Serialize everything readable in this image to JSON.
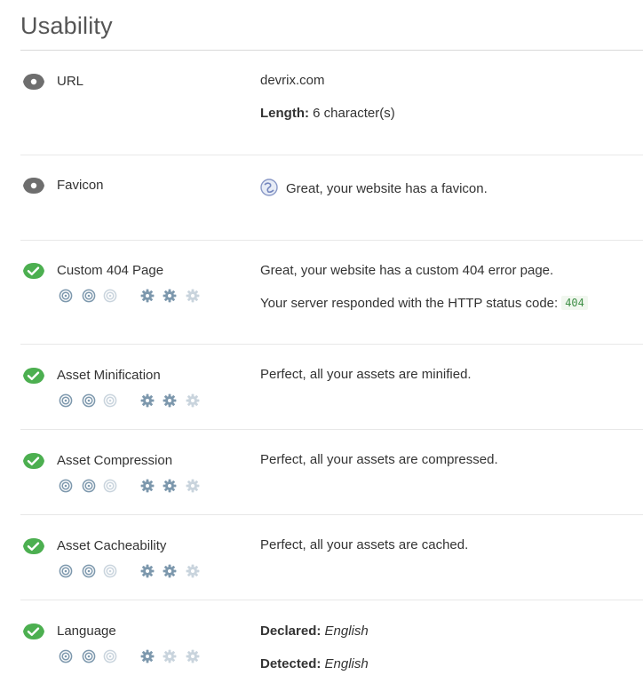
{
  "title": "Usability",
  "colors": {
    "pass": "#4caf50",
    "info": "#6e6e6e",
    "score_on": "#7d98ad",
    "score_off": "#c9d4dd"
  },
  "rows": [
    {
      "status": "info",
      "label": "URL",
      "lines": [
        {
          "text": "devrix.com"
        },
        {
          "key": "Length:",
          "text": "6 character(s)"
        }
      ]
    },
    {
      "status": "info",
      "label": "Favicon",
      "lines": [
        {
          "icon": "globe-favicon-icon",
          "text": "Great, your website has a favicon."
        }
      ]
    },
    {
      "status": "pass",
      "label": "Custom 404 Page",
      "scores": {
        "targets_active": 2,
        "targets_total": 3,
        "gears_active": 2,
        "gears_total": 3
      },
      "lines": [
        {
          "text": "Great, your website has a custom 404 error page."
        },
        {
          "text": "Your server responded with the HTTP status code:",
          "badge": "404"
        }
      ]
    },
    {
      "status": "pass",
      "label": "Asset Minification",
      "scores": {
        "targets_active": 2,
        "targets_total": 3,
        "gears_active": 2,
        "gears_total": 3
      },
      "lines": [
        {
          "text": "Perfect, all your assets are minified."
        }
      ]
    },
    {
      "status": "pass",
      "label": "Asset Compression",
      "scores": {
        "targets_active": 2,
        "targets_total": 3,
        "gears_active": 2,
        "gears_total": 3
      },
      "lines": [
        {
          "text": "Perfect, all your assets are compressed."
        }
      ]
    },
    {
      "status": "pass",
      "label": "Asset Cacheability",
      "scores": {
        "targets_active": 2,
        "targets_total": 3,
        "gears_active": 2,
        "gears_total": 3
      },
      "lines": [
        {
          "text": "Perfect, all your assets are cached."
        }
      ]
    },
    {
      "status": "pass",
      "label": "Language",
      "scores": {
        "targets_active": 2,
        "targets_total": 3,
        "gears_active": 1,
        "gears_total": 3
      },
      "lines": [
        {
          "key": "Declared:",
          "italic": "English"
        },
        {
          "key": "Detected:",
          "italic": "English"
        }
      ]
    }
  ]
}
